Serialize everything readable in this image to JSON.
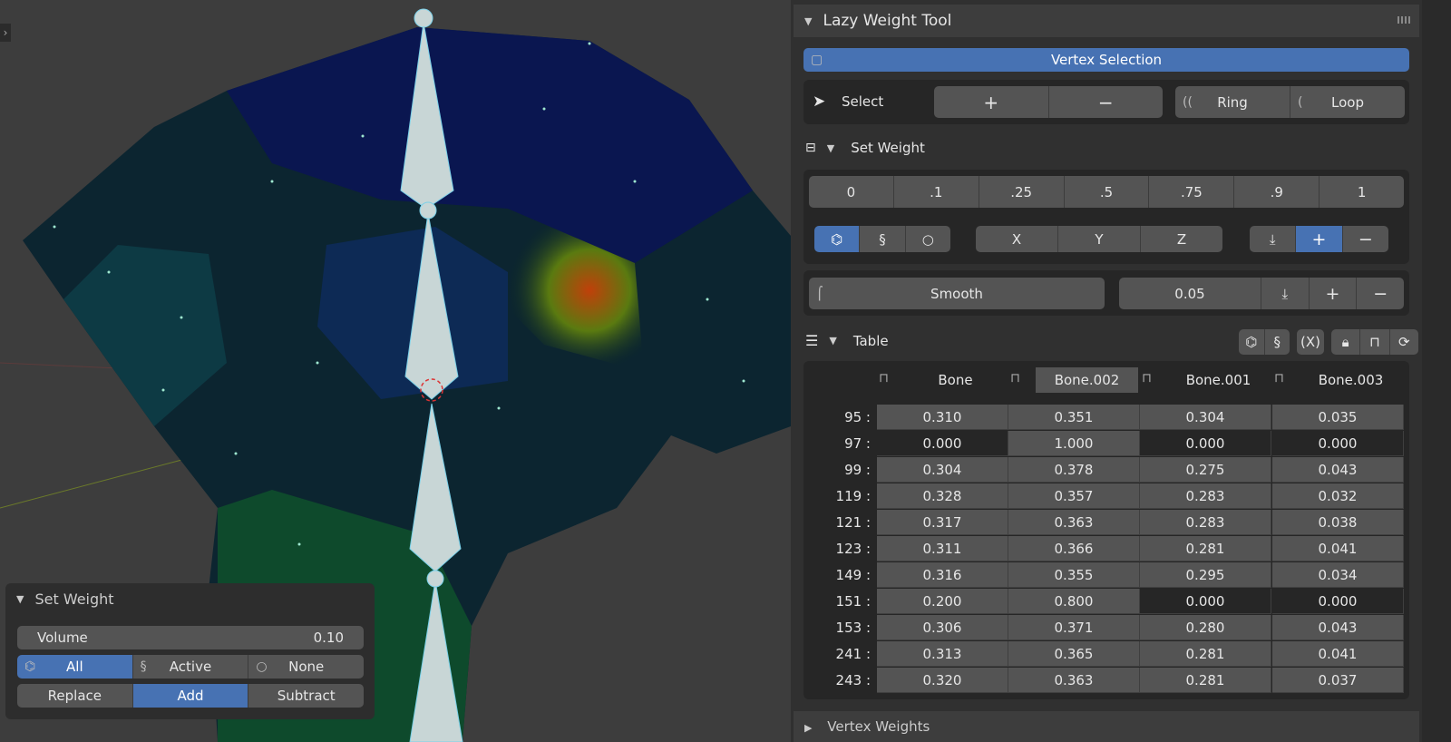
{
  "panel": {
    "title": "Lazy Weight Tool",
    "vertex_selection": "Vertex Selection",
    "select_label": "Select",
    "select_plus": "+",
    "select_minus": "−",
    "ring": "Ring",
    "loop": "Loop",
    "set_weight": {
      "title": "Set Weight",
      "values": [
        "0",
        ".1",
        ".25",
        ".5",
        ".75",
        ".9",
        "1"
      ],
      "axes": [
        "X",
        "Y",
        "Z"
      ],
      "plus": "+",
      "minus": "−",
      "active_mode": "all",
      "active_op": "add"
    },
    "smooth": {
      "label": "Smooth",
      "value": "0.05",
      "plus": "+",
      "minus": "−"
    },
    "table": {
      "title": "Table",
      "x_label": "(X)",
      "columns": [
        "Bone",
        "Bone.002",
        "Bone.001",
        "Bone.003"
      ],
      "selected_column": 1,
      "rows": [
        {
          "id": "95 :",
          "values": [
            "0.310",
            "0.351",
            "0.304",
            "0.035"
          ],
          "dim": [
            0,
            0,
            0,
            0
          ]
        },
        {
          "id": "97 :",
          "values": [
            "0.000",
            "1.000",
            "0.000",
            "0.000"
          ],
          "dim": [
            1,
            0,
            1,
            1
          ]
        },
        {
          "id": "99 :",
          "values": [
            "0.304",
            "0.378",
            "0.275",
            "0.043"
          ],
          "dim": [
            0,
            0,
            0,
            0
          ]
        },
        {
          "id": "119 :",
          "values": [
            "0.328",
            "0.357",
            "0.283",
            "0.032"
          ],
          "dim": [
            0,
            0,
            0,
            0
          ]
        },
        {
          "id": "121 :",
          "values": [
            "0.317",
            "0.363",
            "0.283",
            "0.038"
          ],
          "dim": [
            0,
            0,
            0,
            0
          ]
        },
        {
          "id": "123 :",
          "values": [
            "0.311",
            "0.366",
            "0.281",
            "0.041"
          ],
          "dim": [
            0,
            0,
            0,
            0
          ]
        },
        {
          "id": "149 :",
          "values": [
            "0.316",
            "0.355",
            "0.295",
            "0.034"
          ],
          "dim": [
            0,
            0,
            0,
            0
          ]
        },
        {
          "id": "151 :",
          "values": [
            "0.200",
            "0.800",
            "0.000",
            "0.000"
          ],
          "dim": [
            0,
            0,
            1,
            1
          ]
        },
        {
          "id": "153 :",
          "values": [
            "0.306",
            "0.371",
            "0.280",
            "0.043"
          ],
          "dim": [
            0,
            0,
            0,
            0
          ]
        },
        {
          "id": "241 :",
          "values": [
            "0.313",
            "0.365",
            "0.281",
            "0.041"
          ],
          "dim": [
            0,
            0,
            0,
            0
          ]
        },
        {
          "id": "243 :",
          "values": [
            "0.320",
            "0.363",
            "0.281",
            "0.037"
          ],
          "dim": [
            0,
            0,
            0,
            0
          ]
        }
      ]
    },
    "next_panel": "Vertex Weights"
  },
  "operator_panel": {
    "title": "Set Weight",
    "volume_label": "Volume",
    "volume_value": "0.10",
    "modes": [
      "All",
      "Active",
      "None"
    ],
    "active_mode": 0,
    "ops": [
      "Replace",
      "Add",
      "Subtract"
    ],
    "active_op": 1
  },
  "colors": {
    "accent": "#4772b3",
    "panel": "#303030",
    "button": "#545454"
  }
}
